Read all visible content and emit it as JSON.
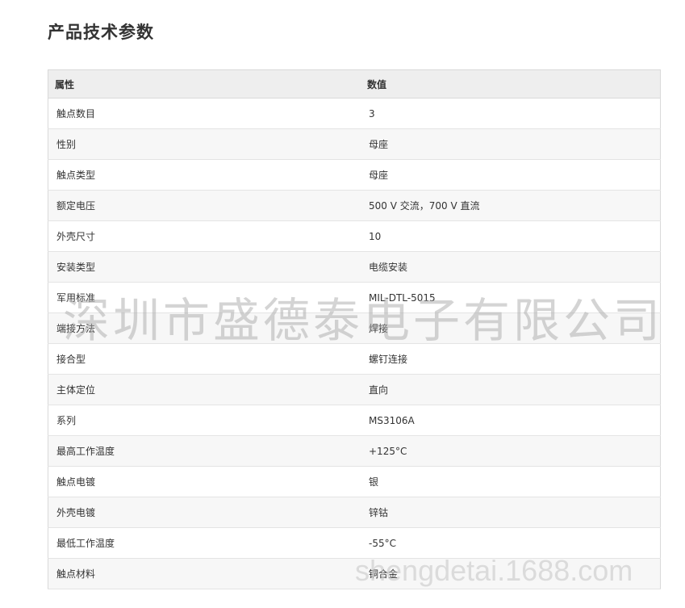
{
  "title": "产品技术参数",
  "table": {
    "headers": {
      "property": "属性",
      "value": "数值"
    },
    "rows": [
      {
        "property": "触点数目",
        "value": "3"
      },
      {
        "property": "性别",
        "value": "母座"
      },
      {
        "property": "触点类型",
        "value": "母座"
      },
      {
        "property": "额定电压",
        "value": "500 V 交流，700 V 直流"
      },
      {
        "property": "外壳尺寸",
        "value": "10"
      },
      {
        "property": "安装类型",
        "value": "电缆安装"
      },
      {
        "property": "军用标准",
        "value": "MIL-DTL-5015"
      },
      {
        "property": "端接方法",
        "value": "焊接"
      },
      {
        "property": "接合型",
        "value": "螺钉连接"
      },
      {
        "property": "主体定位",
        "value": "直向"
      },
      {
        "property": "系列",
        "value": "MS3106A"
      },
      {
        "property": "最高工作温度",
        "value": "+125°C"
      },
      {
        "property": "触点电镀",
        "value": "银"
      },
      {
        "property": "外壳电镀",
        "value": "锌钴"
      },
      {
        "property": "最低工作温度",
        "value": "-55°C"
      },
      {
        "property": "触点材料",
        "value": "铜合金"
      }
    ]
  },
  "watermark": {
    "company": "深圳市盛德泰电子有限公司",
    "url": "shengdetai.1688.com"
  }
}
